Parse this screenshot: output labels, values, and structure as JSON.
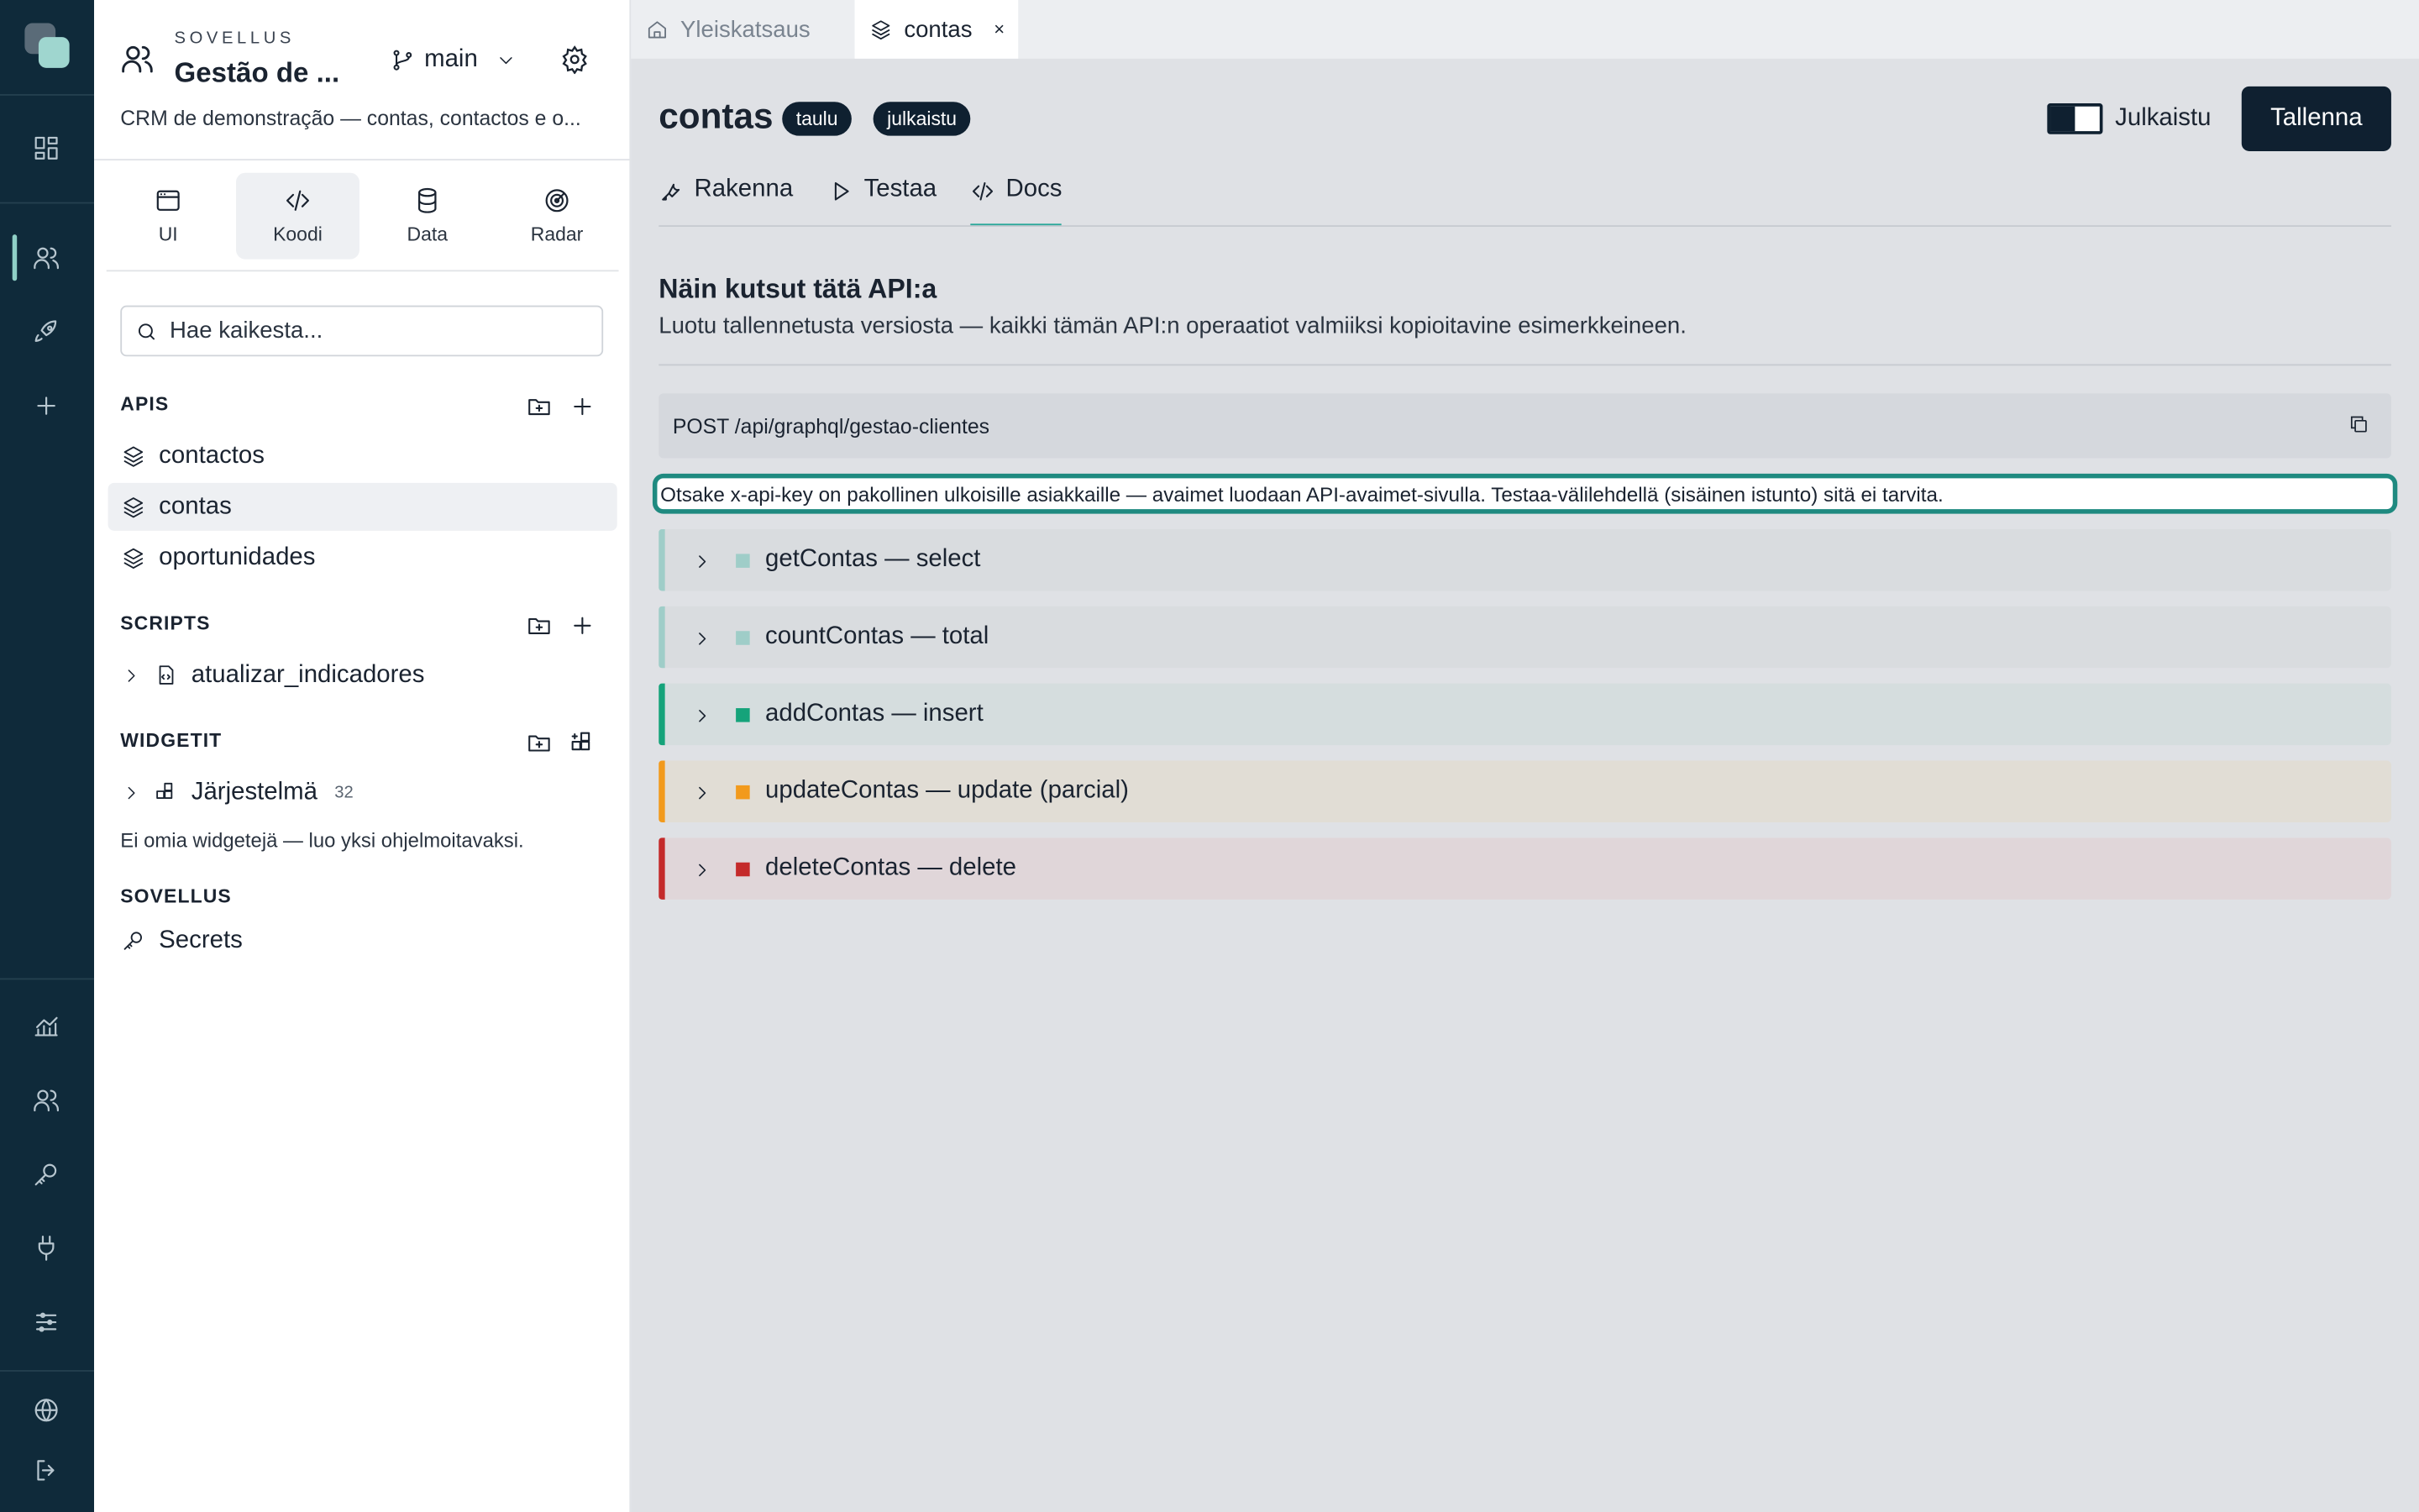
{
  "app": {
    "kicker": "SOVELLUS",
    "name": "Gestão de ...",
    "branch": "main",
    "description": "CRM de demonstração — contas, contactos e o..."
  },
  "modes": [
    {
      "label": "UI",
      "icon": "window-icon"
    },
    {
      "label": "Koodi",
      "icon": "code-icon",
      "active": true
    },
    {
      "label": "Data",
      "icon": "database-icon"
    },
    {
      "label": "Radar",
      "icon": "radar-icon"
    }
  ],
  "search": {
    "placeholder": "Hae kaikesta..."
  },
  "sections": {
    "apis": {
      "title": "APIS",
      "items": [
        {
          "label": "contactos"
        },
        {
          "label": "contas",
          "active": true
        },
        {
          "label": "oportunidades"
        }
      ]
    },
    "scripts": {
      "title": "SCRIPTS",
      "items": [
        {
          "label": "atualizar_indicadores"
        }
      ]
    },
    "widgets": {
      "title": "WIDGETIT",
      "items": [
        {
          "label": "Järjestelmä",
          "count": "32"
        }
      ],
      "empty": "Ei omia widgetejä — luo yksi ohjelmoitavaksi."
    },
    "app": {
      "title": "SOVELLUS",
      "items": [
        {
          "label": "Secrets"
        }
      ]
    }
  },
  "tabs": [
    {
      "label": "Yleiskatsaus",
      "icon": "home-icon"
    },
    {
      "label": "contas",
      "icon": "layers-icon",
      "active": true,
      "close": "×"
    }
  ],
  "page": {
    "title": "contas",
    "badges": [
      "taulu",
      "julkaistu"
    ],
    "toggle_label": "Julkaistu",
    "toggle_on": true,
    "save_label": "Tallenna",
    "subtabs": [
      {
        "label": "Rakenna",
        "icon": "wrench-icon"
      },
      {
        "label": "Testaa",
        "icon": "play-icon"
      },
      {
        "label": "Docs",
        "icon": "code-icon",
        "active": true
      }
    ]
  },
  "docs": {
    "heading": "Näin kutsut tätä API:a",
    "subheading": "Luotu tallennetusta versiosta — kaikki tämän API:n operaatiot valmiiksi kopioitavine esimerkkeineen.",
    "endpoint": "POST /api/graphql/gestao-clientes",
    "note": "Otsake x-api-key on pakollinen ulkoisille asiakkaille — avaimet luodaan API-avaimet-sivulla. Testaa-välilehdellä (sisäinen istunto) sitä ei tarvita.",
    "operations": [
      {
        "label": "getContas — select",
        "bar": "#9fcdc8",
        "square": "#9fcdc8",
        "bg": "#d9dcdf"
      },
      {
        "label": "countContas — total",
        "bar": "#9fcdc8",
        "square": "#9fcdc8",
        "bg": "#d9dcdf"
      },
      {
        "label": "addContas — insert",
        "bar": "#15a37a",
        "square": "#15a37a",
        "bg": "#d5ddde"
      },
      {
        "label": "updateContas — update (parcial)",
        "bar": "#f29a1c",
        "square": "#f29a1c",
        "bg": "#e1ddd5"
      },
      {
        "label": "deleteContas — delete",
        "bar": "#c42a2a",
        "square": "#c42a2a",
        "bg": "#e0d6d9"
      }
    ]
  },
  "colors": {
    "rail": "#0f2a3a",
    "accent": "#2aa79a",
    "dark": "#0f2030"
  }
}
